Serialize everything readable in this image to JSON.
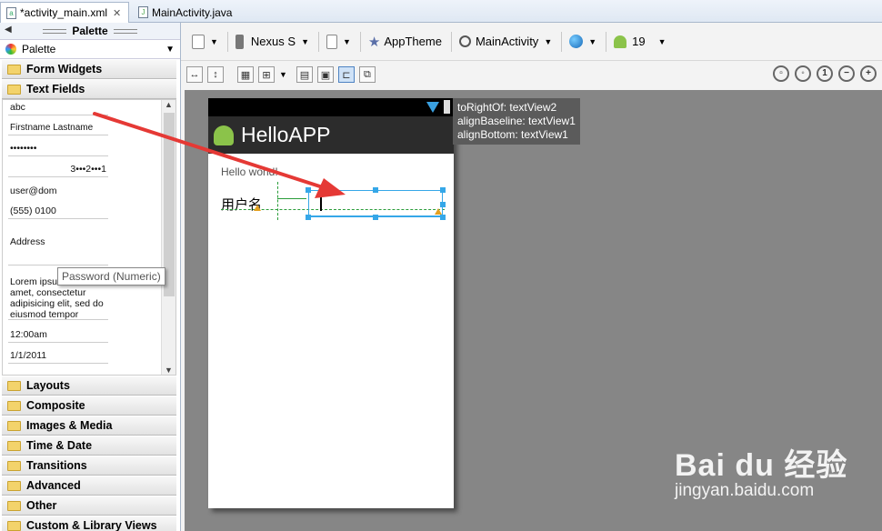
{
  "tabs": [
    {
      "label": "*activity_main.xml",
      "close": "✕",
      "active": true
    },
    {
      "label": "MainActivity.java",
      "active": false
    }
  ],
  "palette": {
    "title": "Palette",
    "selector": "Palette",
    "categories_top": [
      "Form Widgets",
      "Text Fields"
    ],
    "fields": [
      "abc",
      "Firstname Lastname",
      "••••••••",
      "3•••2•••1",
      "user@dom",
      "(555) 0100",
      "Address",
      "Lorem ipsum dolor sit amet, consectetur adipisicing elit, sed do eiusmod tempor",
      "12:00am",
      "1/1/2011"
    ],
    "tooltip": "Password (Numeric)",
    "categories_bottom": [
      "Layouts",
      "Composite",
      "Images & Media",
      "Time & Date",
      "Transitions",
      "Advanced",
      "Other",
      "Custom & Library Views"
    ]
  },
  "toolbar": {
    "device": "Nexus S",
    "theme": "AppTheme",
    "activity": "MainActivity",
    "api": "19"
  },
  "device_screen": {
    "app_title": "HelloAPP",
    "hello_text": "Hello world!",
    "label": "用户名"
  },
  "hint_lines": [
    "toRightOf: textView2",
    "alignBaseline: textView1",
    "alignBottom: textView1"
  ],
  "watermark": {
    "main": "Bai du 经验",
    "sub": "jingyan.baidu.com"
  },
  "colors": {
    "selection": "#35a7e8",
    "guide": "#2a9d3a",
    "arrow": "#e53935",
    "canvas": "#868686"
  }
}
